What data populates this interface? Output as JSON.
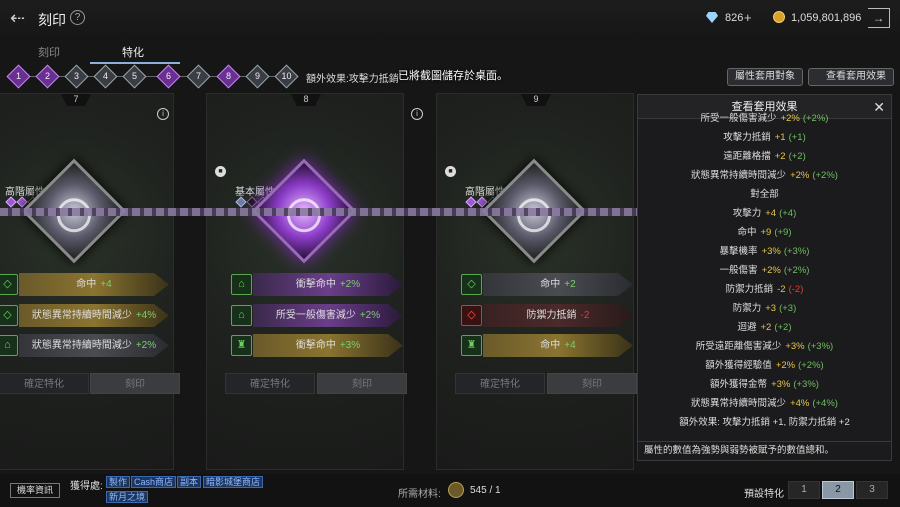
{
  "header": {
    "title": "刻印",
    "help_icon": "question-icon",
    "diamond_amount": "826",
    "diamond_plus": "+",
    "gold_amount": "1,059,801,896"
  },
  "tabs": [
    {
      "label": "刻印"
    },
    {
      "label": "特化"
    }
  ],
  "steps": [
    "1",
    "2",
    "3",
    "4",
    "5",
    "6",
    "7",
    "8",
    "9",
    "10"
  ],
  "extra_effect": "額外效果:攻擊力抵銷",
  "toast": "已將截圖儲存於桌面。",
  "buttons": {
    "apply_target": "屬性套用對象",
    "view_effect": "查看套用效果"
  },
  "cards": [
    {
      "number": "7",
      "type": "高階屬性",
      "rows": [
        {
          "label": "命中",
          "value": "+4"
        },
        {
          "label": "狀態異常持續時間減少",
          "value": "+4%"
        },
        {
          "label": "狀態異常持續時間減少",
          "value": "+2%"
        }
      ],
      "confirm": "確定特化",
      "engrave": "刻印"
    },
    {
      "number": "8",
      "type": "基本屬性",
      "rows": [
        {
          "label": "衝擊命中",
          "value": "+2%"
        },
        {
          "label": "所受一般傷害減少",
          "value": "+2%"
        },
        {
          "label": "衝擊命中",
          "value": "+3%"
        }
      ],
      "confirm": "確定特化",
      "engrave": "刻印"
    },
    {
      "number": "9",
      "type": "高階屬性",
      "rows": [
        {
          "label": "命中",
          "value": "+2"
        },
        {
          "label": "防禦力抵銷",
          "value": "-2"
        },
        {
          "label": "命中",
          "value": "+4"
        }
      ],
      "confirm": "確定特化",
      "engrave": "刻印"
    }
  ],
  "panel": {
    "title": "查看套用效果",
    "items": [
      {
        "name": "所受一般傷害減少",
        "val": "+2%",
        "total": "(+2%)"
      },
      {
        "name": "攻擊力抵銷",
        "val": "+1",
        "total": "(+1)"
      },
      {
        "name": "遠距離格擋",
        "val": "+2",
        "total": "(+2)"
      },
      {
        "name": "狀態異常持續時間減少",
        "val": "+2%",
        "total": "(+2%)"
      },
      {
        "name": "對全部",
        "val": "",
        "total": ""
      },
      {
        "name": "攻擊力",
        "val": "+4",
        "total": "(+4)"
      },
      {
        "name": "命中",
        "val": "+9",
        "total": "(+9)"
      },
      {
        "name": "暴擊機率",
        "val": "+3%",
        "total": "(+3%)"
      },
      {
        "name": "一般傷害",
        "val": "+2%",
        "total": "(+2%)"
      },
      {
        "name": "防禦力抵銷",
        "val": "-2",
        "total": "(-2)"
      },
      {
        "name": "防禦力",
        "val": "+3",
        "total": "(+3)"
      },
      {
        "name": "迴避",
        "val": "+2",
        "total": "(+2)"
      },
      {
        "name": "所受遠距離傷害減少",
        "val": "+3%",
        "total": "(+3%)"
      },
      {
        "name": "額外獲得經驗值",
        "val": "+2%",
        "total": "(+2%)"
      },
      {
        "name": "額外獲得金幣",
        "val": "+3%",
        "total": "(+3%)"
      },
      {
        "name": "狀態異常持續時間減少",
        "val": "+4%",
        "total": "(+4%)"
      },
      {
        "name": "額外效果: 攻擊力抵銷 +1, 防禦力抵銷 +2",
        "val": "",
        "total": ""
      }
    ],
    "footer": "屬性的數值為強勢與弱勢被賦予的數值總和。"
  },
  "bottom": {
    "machine_info": "機率資訊",
    "obtain": "獲得處:",
    "links": [
      "製作",
      "Cash商店",
      "副本",
      "暗影城堡商店",
      "新月之境"
    ],
    "material_label": "所需材料:",
    "material_value": "545 / 1",
    "preset_label": "預設特化",
    "presets": [
      "1",
      "2",
      "3"
    ]
  }
}
